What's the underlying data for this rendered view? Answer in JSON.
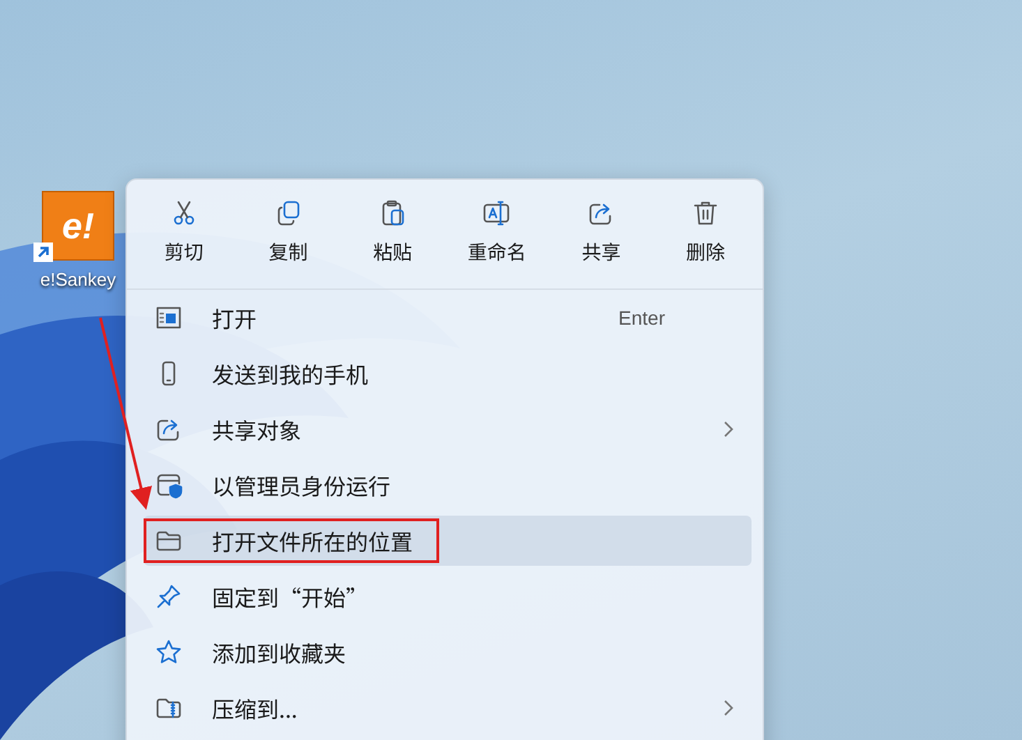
{
  "desktop_icon": {
    "label": "e!Sankey",
    "logo_text": "e!"
  },
  "context_menu": {
    "toolbar": [
      {
        "label": "剪切"
      },
      {
        "label": "复制"
      },
      {
        "label": "粘贴"
      },
      {
        "label": "重命名"
      },
      {
        "label": "共享"
      },
      {
        "label": "删除"
      }
    ],
    "items": [
      {
        "label": "打开",
        "shortcut": "Enter",
        "submenu": false,
        "selected": false,
        "annotated": false
      },
      {
        "label": "发送到我的手机",
        "submenu": false,
        "selected": false,
        "annotated": false
      },
      {
        "label": "共享对象",
        "submenu": true,
        "selected": false,
        "annotated": false
      },
      {
        "label": "以管理员身份运行",
        "submenu": false,
        "selected": false,
        "annotated": false
      },
      {
        "label": "打开文件所在的位置",
        "submenu": false,
        "selected": true,
        "annotated": true
      },
      {
        "label": "固定到“开始”",
        "submenu": false,
        "selected": false,
        "annotated": false
      },
      {
        "label": "添加到收藏夹",
        "submenu": false,
        "selected": false,
        "annotated": false
      },
      {
        "label": "压缩到...",
        "submenu": true,
        "selected": false,
        "annotated": false
      }
    ]
  }
}
